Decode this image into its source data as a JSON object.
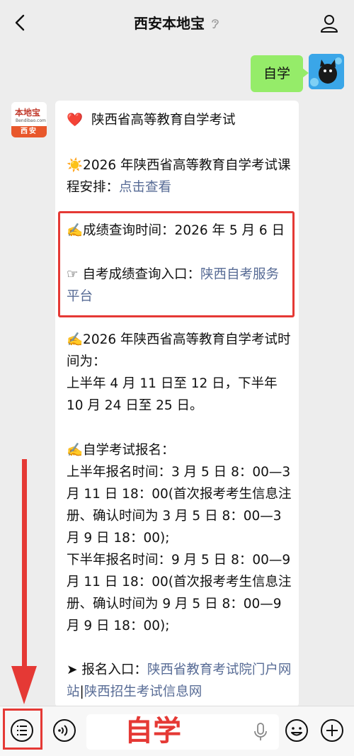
{
  "header": {
    "title": "西安本地宝"
  },
  "chat": {
    "outgoing": {
      "text": "自学"
    },
    "incoming_avatar": {
      "logo_text": "本地宝",
      "logo_sub": "Bendibao.com",
      "city": "西安"
    },
    "incoming": {
      "line1_emoji": "❤️",
      "line1": "陕西省高等教育自学考试",
      "p2_emoji": "☀️",
      "p2_text": "2026 年陕西省高等教育自学考试课程安排：",
      "p2_link": "点击查看",
      "p3_emoji": "✍️",
      "p3_text": "成绩查询时间：2026 年 5 月 6 日",
      "p4_emoji": "☞",
      "p4_text": "自考成绩查询入口：",
      "p4_link": "陕西自考服务平台",
      "p5_emoji": "✍️",
      "p5_text_a": "2026 年陕西省高等教育自学考试时间为：",
      "p5_text_b": "上半年 4 月 11 日至 12 日，下半年 10 月 24 日至 25 日。",
      "p6_emoji": "✍️",
      "p6_title": "自学考试报名：",
      "p6_line1": "上半年报名时间：3 月 5 日 8：00—3 月 11 日 18：00(首次报考考生信息注册、确认时间为 3 月 5 日 8：00—3 月 9 日 18：00);",
      "p6_line2": "下半年报名时间：9 月 5 日 8：00—9 月 11 日 18：00(首次报考考生信息注册、确认时间为 9 月 5 日 8：00—9 月 9 日 18：00);",
      "p7_emoji": "➤",
      "p7_text": "报名入口：",
      "p7_link1": "陕西省教育考试院门户网站",
      "p7_sep": "|",
      "p7_link2": "陕西招生考试信息网"
    }
  },
  "input": {
    "text": "自学"
  },
  "colors": {
    "bubble_out": "#95ec69",
    "link": "#576b95",
    "highlight": "#e53935"
  }
}
